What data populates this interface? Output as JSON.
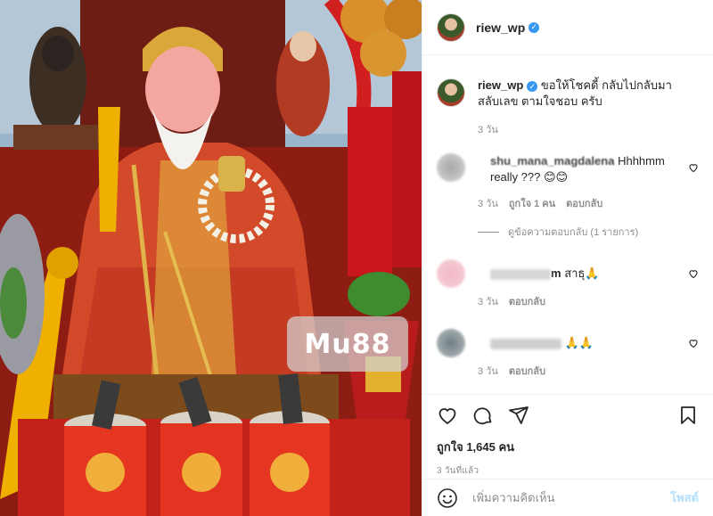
{
  "post": {
    "watermark": "Mu88",
    "author": {
      "username": "riew_wp"
    }
  },
  "caption": {
    "username": "riew_wp",
    "text": "ขอให้โชคดี้ กลับไปกลับมา สลับเลข ตามใจชอบ ครับ",
    "time": "3 วัน"
  },
  "comments": [
    {
      "username": "shu_mana_magdalena",
      "text": "Hhhhmm really ??? 😊😊",
      "time": "3 วัน",
      "likes": "ถูกใจ 1 คน",
      "reply": "ตอบกลับ",
      "view_replies": "ดูข้อความตอบกลับ (1 รายการ)"
    },
    {
      "username_tail": "m",
      "text": "สาธุ🙏",
      "time": "3 วัน",
      "reply": "ตอบกลับ"
    },
    {
      "text": "🙏🙏",
      "time": "3 วัน",
      "reply": "ตอบกลับ"
    }
  ],
  "actions": {
    "likes": "ถูกใจ 1,645 คน",
    "posted": "3 วันที่แล้ว"
  },
  "add_comment": {
    "placeholder": "เพิ่มความคิดเห็น",
    "post_label": "โพสต์"
  },
  "icons": [
    "verified-badge-icon",
    "heart-icon",
    "comment-icon",
    "share-icon",
    "bookmark-icon",
    "emoji-icon"
  ],
  "colors": {
    "link_blue": "#3897f0",
    "muted": "#8e8e8e",
    "post_disabled": "#b2dffc",
    "border": "#efefef"
  }
}
